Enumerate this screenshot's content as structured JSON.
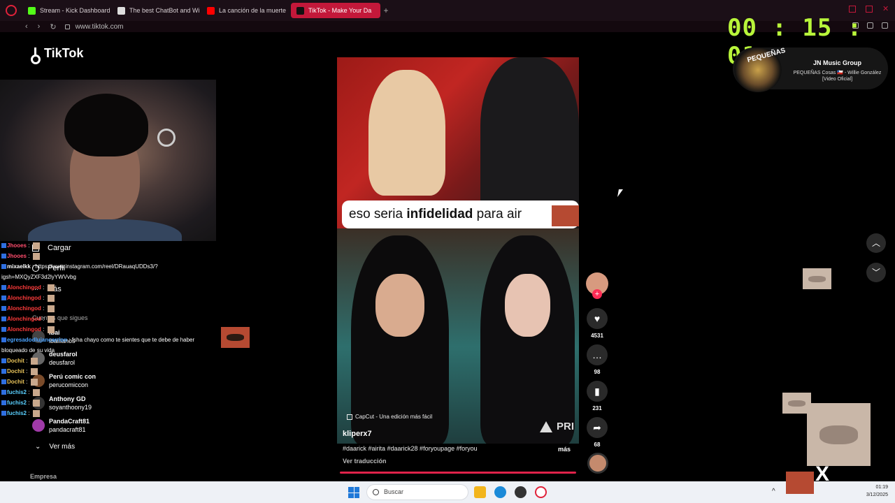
{
  "tabs": [
    {
      "label": "Stream - Kick Dashboard",
      "color": "#53fc18"
    },
    {
      "label": "The best ChatBot and Wi",
      "color": "#dddddd"
    },
    {
      "label": "La canción de la muerte",
      "color": "#ff0000"
    },
    {
      "label": "TikTok - Make Your Da",
      "color": "#ffffff",
      "active": true
    }
  ],
  "address": {
    "url": "www.tiktok.com"
  },
  "timer": "00 : 15 : 01",
  "tiktok": {
    "logo": "TikTok",
    "menu": [
      {
        "label": "Cargar",
        "icon": "plus-box-icon"
      },
      {
        "label": "Perfil",
        "icon": "person-icon"
      },
      {
        "label": "Más",
        "icon": "more-icon"
      }
    ],
    "following_header": "Cuentas que sigues",
    "accounts": [
      {
        "name": "ibai",
        "handle": "ibaillanos"
      },
      {
        "name": "deusfarol",
        "handle": "deusfarol"
      },
      {
        "name": "Perú comic con",
        "handle": "perucomiccon"
      },
      {
        "name": "Anthony GD",
        "handle": "soyanthoony19"
      },
      {
        "name": "PandaCraft81",
        "handle": "pandacraft81"
      }
    ],
    "see_more": "Ver más",
    "company": "Empresa"
  },
  "chat": [
    {
      "user": "Jhooes",
      "text": "",
      "color": "#ff4d6d"
    },
    {
      "user": "Jhooes",
      "text": "",
      "color": "#ff4d6d"
    },
    {
      "user": "mixaelkk",
      "text": "https://www.instagram.com/reel/DRauaqUDDs3/?",
      "color": "#ffffff"
    },
    {
      "user": "",
      "text": "igsh=MXQyZXF3d2lyYWVvbg",
      "color": "#ffffff"
    },
    {
      "user": "Alonchingod",
      "text": "",
      "color": "#ff3b3b"
    },
    {
      "user": "Alonchingod",
      "text": "",
      "color": "#ff3b3b"
    },
    {
      "user": "Alonchingod",
      "text": "",
      "color": "#ff3b3b"
    },
    {
      "user": "Alonchingod",
      "text": "",
      "color": "#ff3b3b"
    },
    {
      "user": "Alonchingod",
      "text": "",
      "color": "#ff3b3b"
    },
    {
      "user": "egresadodlujancarrion",
      "text": "fsha chayo como te sientes que te debe de haber",
      "color": "#4aa3ff"
    },
    {
      "user": "",
      "text": "bloqueado de su vida",
      "color": "#ffffff"
    },
    {
      "user": "Dochit",
      "text": "",
      "color": "#e8c35a"
    },
    {
      "user": "Dochit",
      "text": "",
      "color": "#e8c35a"
    },
    {
      "user": "Dochit",
      "text": "",
      "color": "#e8c35a"
    },
    {
      "user": "fuchis2",
      "text": "",
      "color": "#5ad0ff"
    },
    {
      "user": "fuchis2",
      "text": "",
      "color": "#5ad0ff"
    },
    {
      "user": "fuchis2",
      "text": "",
      "color": "#5ad0ff"
    }
  ],
  "video": {
    "caption_pre": "eso seria ",
    "caption_bold": "infidelidad",
    "caption_post": " para air",
    "capcut": "CapCut - Una edición más fácil",
    "watermark": "PRI",
    "author": "kliperx7",
    "hashtags": "#daarick #airita #daarick28 #foryoupage #foryou",
    "more": "más",
    "translate": "Ver traducción"
  },
  "actions": {
    "likes": "4531",
    "comments": "98",
    "saves": "231",
    "shares": "68"
  },
  "music": {
    "artist": "JN Music Group",
    "song": "PEQUEÑAS Cosas 🇨🇱 - Willie González [Video Oficial]",
    "cover_text": "PEQUEÑAS"
  },
  "overlay": {
    "close_glyph": "X"
  },
  "taskbar": {
    "search_placeholder": "Buscar",
    "time": "01:19",
    "date": "3/12/2025"
  }
}
